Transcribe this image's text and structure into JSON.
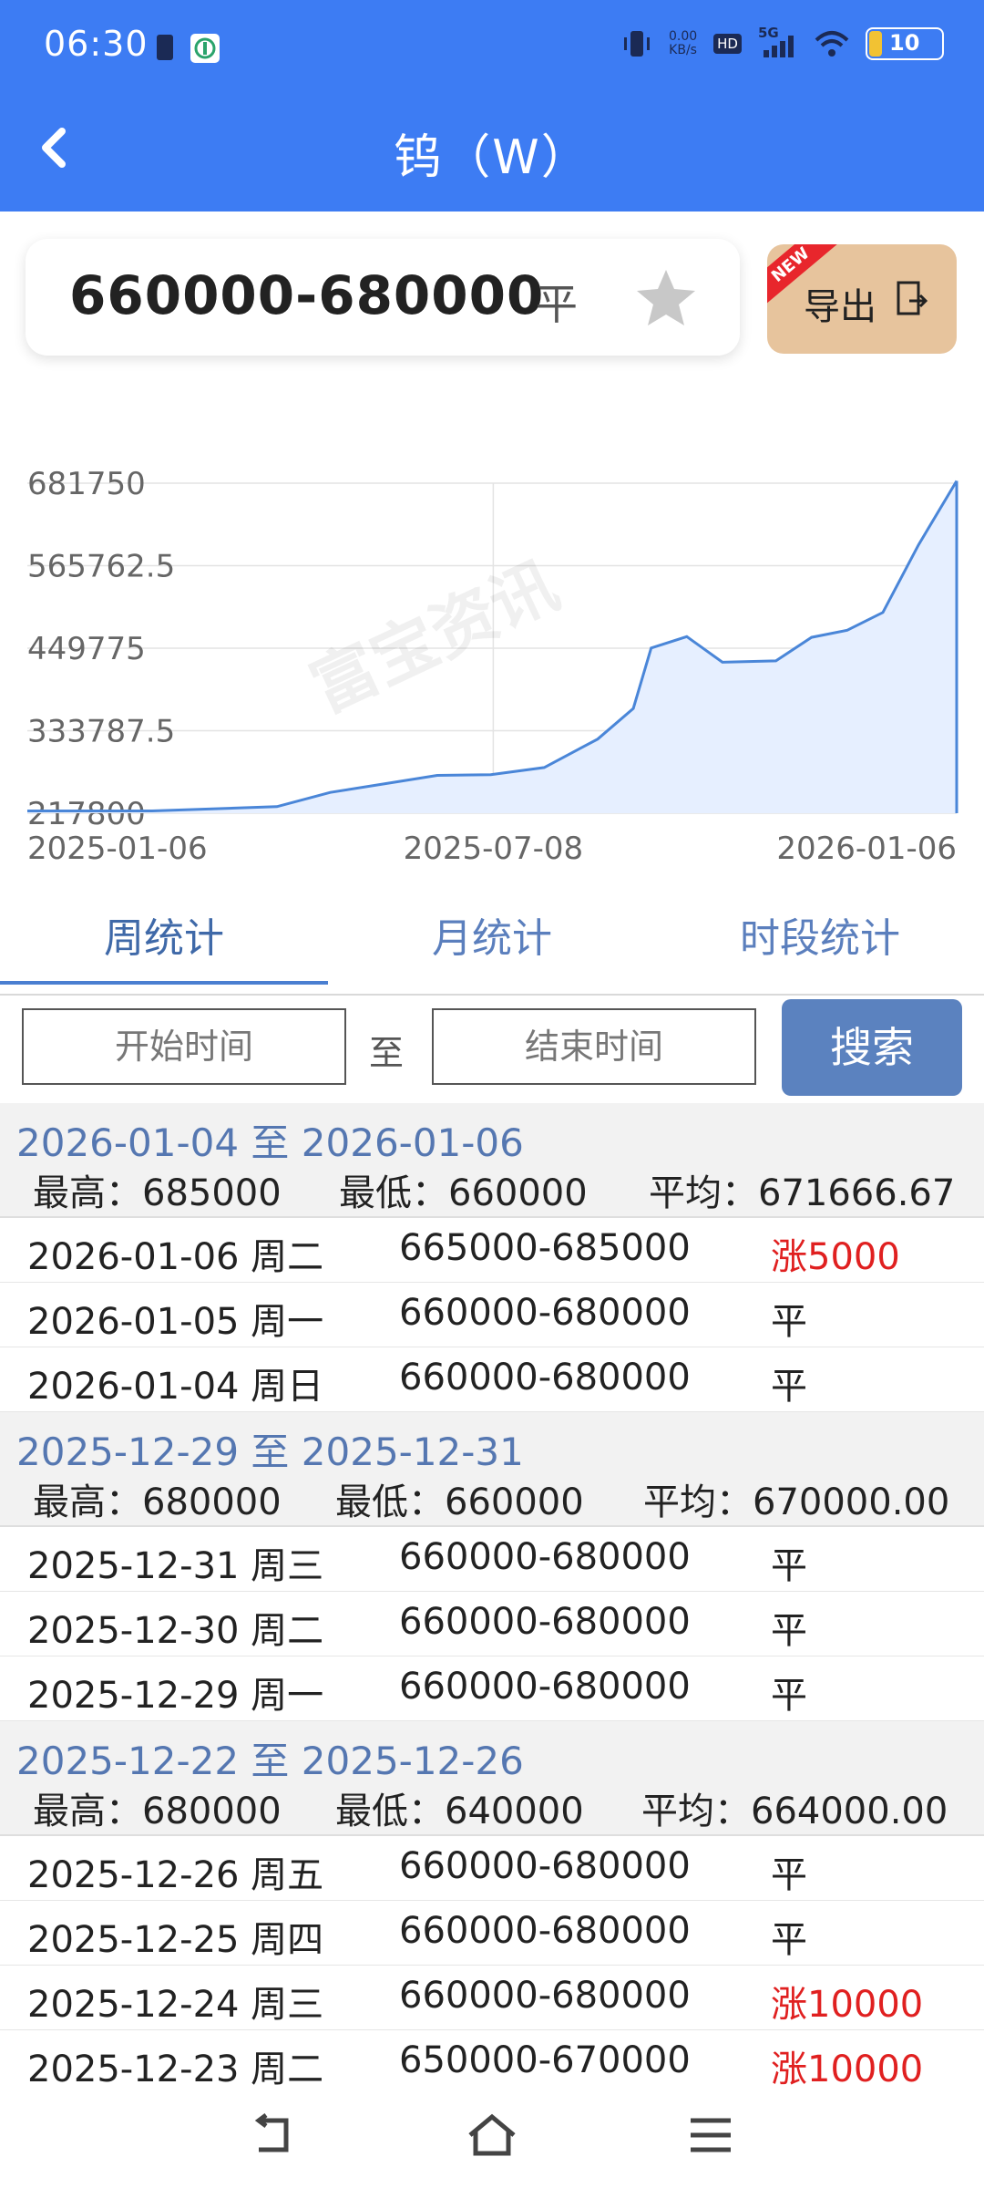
{
  "status": {
    "time": "06:30",
    "net_speed_top": "0.00",
    "net_speed_bottom": "KB/s",
    "hd": "HD",
    "signal": "5G",
    "battery": "10"
  },
  "header": {
    "title": "钨（W）"
  },
  "price": {
    "range": "660000-680000",
    "status": "平",
    "export_label": "导出",
    "new_badge": "NEW"
  },
  "chart_data": {
    "type": "area",
    "x_ticks": [
      "2025-01-06",
      "2025-07-08",
      "2026-01-06"
    ],
    "y_ticks": [
      "681750",
      "565762.5",
      "449775",
      "333787.5",
      "217800"
    ],
    "ylim": [
      217800,
      681750
    ],
    "grid": true,
    "color": "#4a86d8",
    "fill": "#e6efff",
    "x": [
      "2025-01-06",
      "2025-02-24",
      "2025-04-14",
      "2025-05-05",
      "2025-05-26",
      "2025-06-16",
      "2025-07-07",
      "2025-07-28",
      "2025-08-18",
      "2025-09-01",
      "2025-09-08",
      "2025-09-22",
      "2025-10-06",
      "2025-10-27",
      "2025-11-10",
      "2025-11-24",
      "2025-12-08",
      "2025-12-22",
      "2026-01-06"
    ],
    "y": [
      221000,
      221000,
      227000,
      247000,
      259000,
      271000,
      272000,
      282000,
      322000,
      365000,
      450000,
      466000,
      430000,
      432000,
      465000,
      475000,
      500000,
      595000,
      685000
    ]
  },
  "watermark": "富宝资讯",
  "tabs": [
    "周统计",
    "月统计",
    "时段统计"
  ],
  "search": {
    "start_placeholder": "开始时间",
    "to": "至",
    "end_placeholder": "结束时间",
    "button": "搜索"
  },
  "groups": [
    {
      "range": "2026-01-04 至 2026-01-06",
      "high": "最高：685000",
      "low": "最低：660000",
      "avg": "平均：671666.67",
      "rows": [
        {
          "date": "2026-01-06 周二",
          "range": "665000-685000",
          "change": "涨5000",
          "up": true
        },
        {
          "date": "2026-01-05 周一",
          "range": "660000-680000",
          "change": "平",
          "up": false
        },
        {
          "date": "2026-01-04 周日",
          "range": "660000-680000",
          "change": "平",
          "up": false
        }
      ]
    },
    {
      "range": "2025-12-29 至 2025-12-31",
      "high": "最高：680000",
      "low": "最低：660000",
      "avg": "平均：670000.00",
      "rows": [
        {
          "date": "2025-12-31 周三",
          "range": "660000-680000",
          "change": "平",
          "up": false
        },
        {
          "date": "2025-12-30 周二",
          "range": "660000-680000",
          "change": "平",
          "up": false
        },
        {
          "date": "2025-12-29 周一",
          "range": "660000-680000",
          "change": "平",
          "up": false
        }
      ]
    },
    {
      "range": "2025-12-22 至 2025-12-26",
      "high": "最高：680000",
      "low": "最低：640000",
      "avg": "平均：664000.00",
      "rows": [
        {
          "date": "2025-12-26 周五",
          "range": "660000-680000",
          "change": "平",
          "up": false
        },
        {
          "date": "2025-12-25 周四",
          "range": "660000-680000",
          "change": "平",
          "up": false
        },
        {
          "date": "2025-12-24 周三",
          "range": "660000-680000",
          "change": "涨10000",
          "up": true
        },
        {
          "date": "2025-12-23 周二",
          "range": "650000-670000",
          "change": "涨10000",
          "up": true
        }
      ]
    }
  ]
}
